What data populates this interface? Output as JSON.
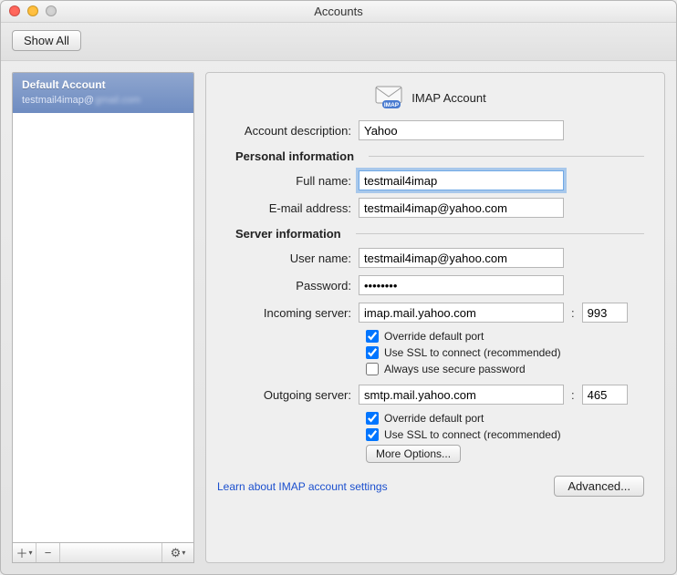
{
  "window": {
    "title": "Accounts"
  },
  "toolbar": {
    "showAll": "Show All"
  },
  "sidebar": {
    "account": {
      "title": "Default Account",
      "email": "testmail4imap@"
    }
  },
  "header": {
    "type": "IMAP Account"
  },
  "labels": {
    "desc": "Account description:",
    "personal": "Personal information",
    "fullname": "Full name:",
    "email": "E-mail address:",
    "server": "Server information",
    "username": "User name:",
    "password": "Password:",
    "incoming": "Incoming server:",
    "outgoing": "Outgoing server:",
    "override": "Override default port",
    "ssl": "Use SSL to connect (recommended)",
    "secure": "Always use secure password",
    "more": "More Options...",
    "learn": "Learn about IMAP account settings",
    "advanced": "Advanced..."
  },
  "values": {
    "desc": "Yahoo",
    "fullname": "testmail4imap",
    "email": "testmail4imap@yahoo.com",
    "username": "testmail4imap@yahoo.com",
    "password": "••••••••",
    "incomingServer": "imap.mail.yahoo.com",
    "incomingPort": "993",
    "outgoingServer": "smtp.mail.yahoo.com",
    "outgoingPort": "465",
    "in_override": true,
    "in_ssl": true,
    "in_secure": false,
    "out_override": true,
    "out_ssl": true
  }
}
